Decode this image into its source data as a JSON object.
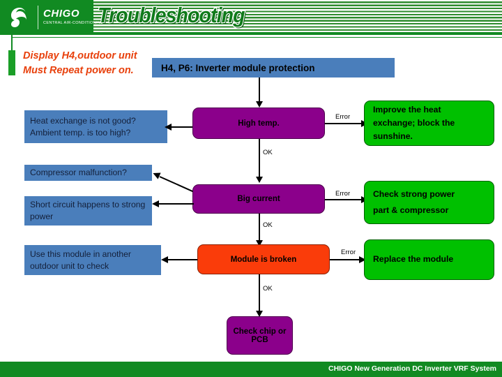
{
  "header": {
    "title": "Troubleshooting",
    "brand_name": "CHIGO",
    "brand_tagline": "CENTRAL AIR-CONDITIONING",
    "logo_icon": "chigo-swirl-logo"
  },
  "intro": {
    "text": "Display H4,outdoor unit Must Repeat power on."
  },
  "flow": {
    "title_box": {
      "label": "H4, P6: Inverter module protection"
    },
    "rows": [
      {
        "state": "High temp.",
        "state_color": "#8B008B",
        "questions": [
          "Heat exchange is not good?",
          "Ambient temp. is too high?"
        ],
        "error_label": "Error",
        "ok_label": "OK",
        "action": [
          "Improve the heat",
          "exchange; block the",
          "sunshine."
        ]
      },
      {
        "state": "Big current",
        "state_color": "#8B008B",
        "questions": [
          "Compressor malfunction?",
          "Short circuit happens to strong power"
        ],
        "error_label": "Error",
        "ok_label": "OK",
        "action": [
          "Check strong power",
          "part & compressor"
        ]
      },
      {
        "state": "Module is broken",
        "state_color": "#FA3C0A",
        "questions": [
          "Use this module in another outdoor unit to check"
        ],
        "error_label": "Error",
        "ok_label": "OK",
        "action": [
          "Replace the module"
        ]
      }
    ],
    "final_box": {
      "line1": "Check chip or",
      "line2": "PCB",
      "color": "#8B008B"
    }
  },
  "footer": {
    "text": "CHIGO New Generation DC Inverter VRF System"
  },
  "colors": {
    "brand_green": "#118A22",
    "accent_green": "#1A9E27",
    "action_green": "#00C000",
    "box_blue": "#4A7EBB",
    "state_purple": "#8B008B",
    "state_red": "#FA3C0A",
    "intro_red": "#E8400C"
  }
}
